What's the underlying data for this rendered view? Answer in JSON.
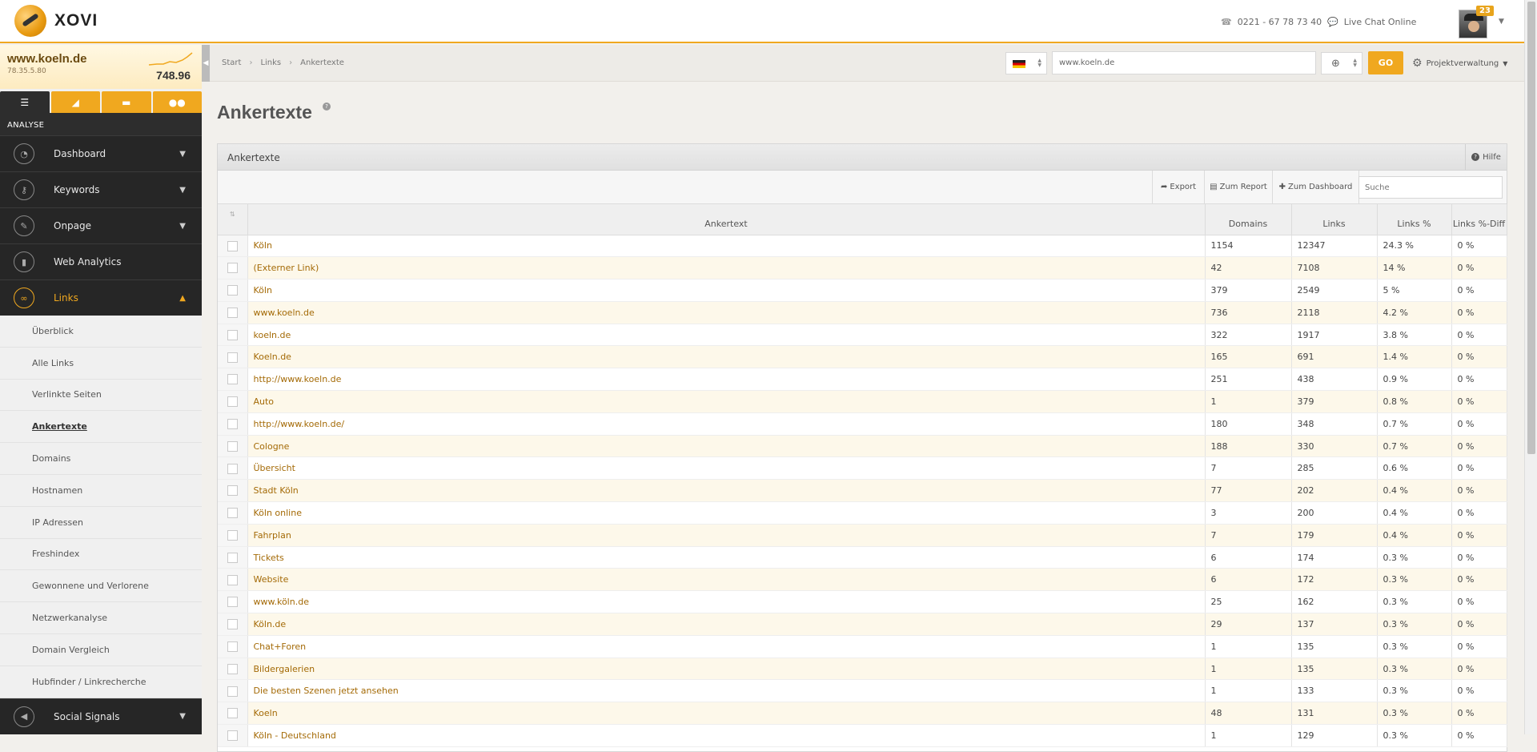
{
  "brand": {
    "name": "XOVI"
  },
  "header": {
    "phone": "0221 - 67 78 73 40",
    "chat": "Live Chat Online",
    "notifications": "23"
  },
  "site": {
    "domain": "www.koeln.de",
    "ip": "78.35.5.80",
    "score": "748.96"
  },
  "sidebar": {
    "section": "ANALYSE",
    "nav": [
      {
        "label": "Dashboard",
        "icon": "gauge-icon"
      },
      {
        "label": "Keywords",
        "icon": "key-icon"
      },
      {
        "label": "Onpage",
        "icon": "wrench-icon"
      },
      {
        "label": "Web Analytics",
        "icon": "bar-chart-icon"
      },
      {
        "label": "Links",
        "icon": "link-icon"
      }
    ],
    "sub": [
      "Überblick",
      "Alle Links",
      "Verlinkte Seiten",
      "Ankertexte",
      "Domains",
      "Hostnamen",
      "IP Adressen",
      "Freshindex",
      "Gewonnene und Verlorene",
      "Netzwerkanalyse",
      "Domain Vergleich",
      "Hubfinder / Linkrecherche"
    ],
    "after": {
      "label": "Social Signals",
      "icon": "megaphone-icon"
    }
  },
  "breadcrumb": [
    "Start",
    "Links",
    "Ankertexte"
  ],
  "url_field": {
    "value": "www.koeln.de"
  },
  "go_label": "GO",
  "project_label": "Projektverwaltung",
  "page_title": "Ankertexte",
  "panel": {
    "title": "Ankertexte",
    "help": "Hilfe",
    "export": "Export",
    "report": "Zum Report",
    "dashboard": "Zum Dashboard",
    "search_placeholder": "Suche"
  },
  "table": {
    "headers": [
      "Ankertext",
      "Domains",
      "Links",
      "Links %",
      "Links %-Diff"
    ],
    "rows": [
      [
        "Köln",
        "1154",
        "12347",
        "24.3 %",
        "0 %"
      ],
      [
        "(Externer Link)",
        "42",
        "7108",
        "14 %",
        "0 %"
      ],
      [
        "Köln",
        "379",
        "2549",
        "5 %",
        "0 %"
      ],
      [
        "www.koeln.de",
        "736",
        "2118",
        "4.2 %",
        "0 %"
      ],
      [
        "koeln.de",
        "322",
        "1917",
        "3.8 %",
        "0 %"
      ],
      [
        "Koeln.de",
        "165",
        "691",
        "1.4 %",
        "0 %"
      ],
      [
        "http://www.koeln.de",
        "251",
        "438",
        "0.9 %",
        "0 %"
      ],
      [
        "Auto",
        "1",
        "379",
        "0.8 %",
        "0 %"
      ],
      [
        "http://www.koeln.de/",
        "180",
        "348",
        "0.7 %",
        "0 %"
      ],
      [
        "Cologne",
        "188",
        "330",
        "0.7 %",
        "0 %"
      ],
      [
        "Übersicht",
        "7",
        "285",
        "0.6 %",
        "0 %"
      ],
      [
        "Stadt Köln",
        "77",
        "202",
        "0.4 %",
        "0 %"
      ],
      [
        "Köln online",
        "3",
        "200",
        "0.4 %",
        "0 %"
      ],
      [
        "Fahrplan",
        "7",
        "179",
        "0.4 %",
        "0 %"
      ],
      [
        "Tickets",
        "6",
        "174",
        "0.3 %",
        "0 %"
      ],
      [
        "Website",
        "6",
        "172",
        "0.3 %",
        "0 %"
      ],
      [
        "www.köln.de",
        "25",
        "162",
        "0.3 %",
        "0 %"
      ],
      [
        "Köln.de",
        "29",
        "137",
        "0.3 %",
        "0 %"
      ],
      [
        "Chat+Foren",
        "1",
        "135",
        "0.3 %",
        "0 %"
      ],
      [
        "Bildergalerien",
        "1",
        "135",
        "0.3 %",
        "0 %"
      ],
      [
        "Die besten Szenen jetzt ansehen",
        "1",
        "133",
        "0.3 %",
        "0 %"
      ],
      [
        "Koeln",
        "48",
        "131",
        "0.3 %",
        "0 %"
      ],
      [
        "Köln - Deutschland",
        "1",
        "129",
        "0.3 %",
        "0 %"
      ]
    ]
  },
  "colors": {
    "accent": "#f0a81f",
    "sidebar": "#2d2d2d",
    "link": "#a46a06"
  }
}
